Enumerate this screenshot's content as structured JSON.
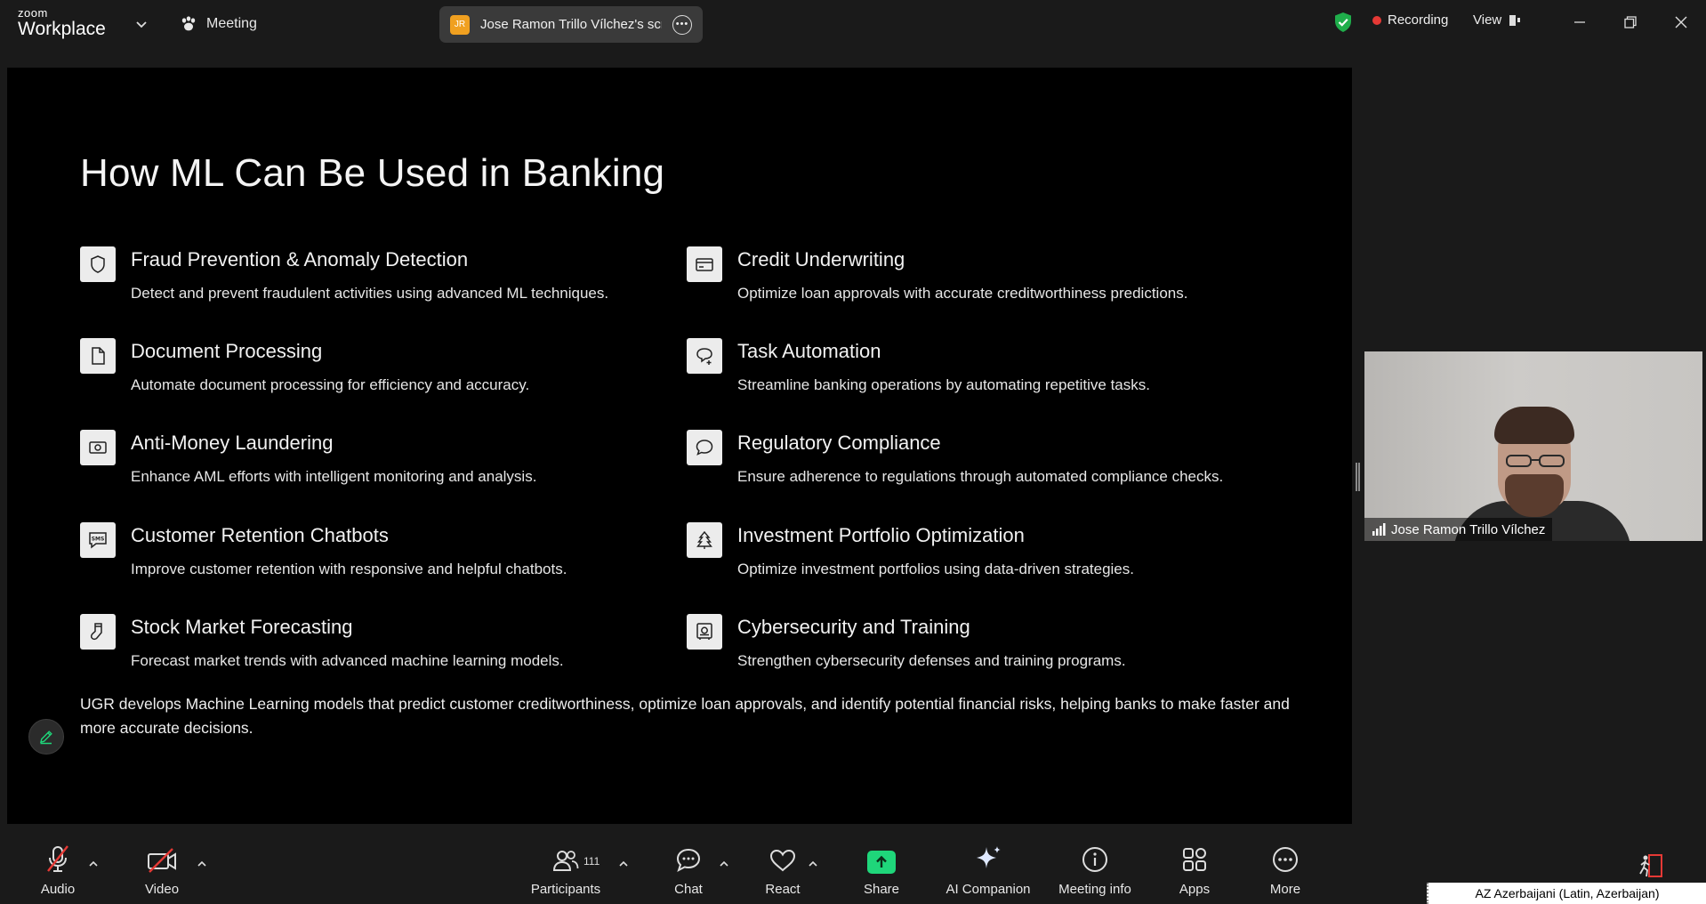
{
  "app": {
    "brand_top": "zoom",
    "brand_bottom": "Workplace",
    "meeting_label": "Meeting",
    "sharer_initials": "JR",
    "sharer_screen": "Jose Ramon Trillo Vílchez's scree",
    "recording_label": "Recording",
    "view_label": "View",
    "colors": {
      "recording": "#e53935",
      "shield": "#1fae4b",
      "share": "#1fd67a",
      "avatar": "#f0a020"
    }
  },
  "slide": {
    "title": "How ML Can Be Used in Banking",
    "features": [
      {
        "icon": "shield-icon",
        "title": "Fraud Prevention & Anomaly Detection",
        "desc": "Detect and prevent fraudulent activities using advanced ML techniques."
      },
      {
        "icon": "credit-card-icon",
        "title": "Credit Underwriting",
        "desc": "Optimize loan approvals with accurate creditworthiness predictions."
      },
      {
        "icon": "document-icon",
        "title": "Document Processing",
        "desc": "Automate document processing for efficiency and accuracy."
      },
      {
        "icon": "automation-icon",
        "title": "Task Automation",
        "desc": "Streamline banking operations by automating repetitive tasks."
      },
      {
        "icon": "banknote-icon",
        "title": "Anti-Money Laundering",
        "desc": "Enhance AML efforts with intelligent monitoring and analysis."
      },
      {
        "icon": "chat-bubble-icon",
        "title": "Regulatory Compliance",
        "desc": "Ensure adherence to regulations through automated compliance checks."
      },
      {
        "icon": "sms-icon",
        "title": "Customer Retention Chatbots",
        "desc": "Improve customer retention with responsive and helpful chatbots."
      },
      {
        "icon": "tree-icon",
        "title": "Investment Portfolio Optimization",
        "desc": "Optimize investment portfolios using data-driven strategies."
      },
      {
        "icon": "sock-icon",
        "title": "Stock Market Forecasting",
        "desc": "Forecast market trends with advanced machine learning models."
      },
      {
        "icon": "safe-icon",
        "title": "Cybersecurity and Training",
        "desc": "Strengthen cybersecurity defenses and training programs."
      }
    ],
    "summary": "UGR develops Machine Learning models that predict customer creditworthiness, optimize loan approvals, and identify potential financial risks, helping banks to make faster and more accurate decisions."
  },
  "video": {
    "participant_name": "Jose Ramon Trillo Vílchez"
  },
  "toolbar": {
    "audio": "Audio",
    "video": "Video",
    "participants": "Participants",
    "participant_count": "111",
    "chat": "Chat",
    "react": "React",
    "share": "Share",
    "ai_companion": "AI Companion",
    "meeting_info": "Meeting info",
    "apps": "Apps",
    "more": "More"
  },
  "system": {
    "language": "AZ Azerbaijani (Latin, Azerbaijan)"
  }
}
